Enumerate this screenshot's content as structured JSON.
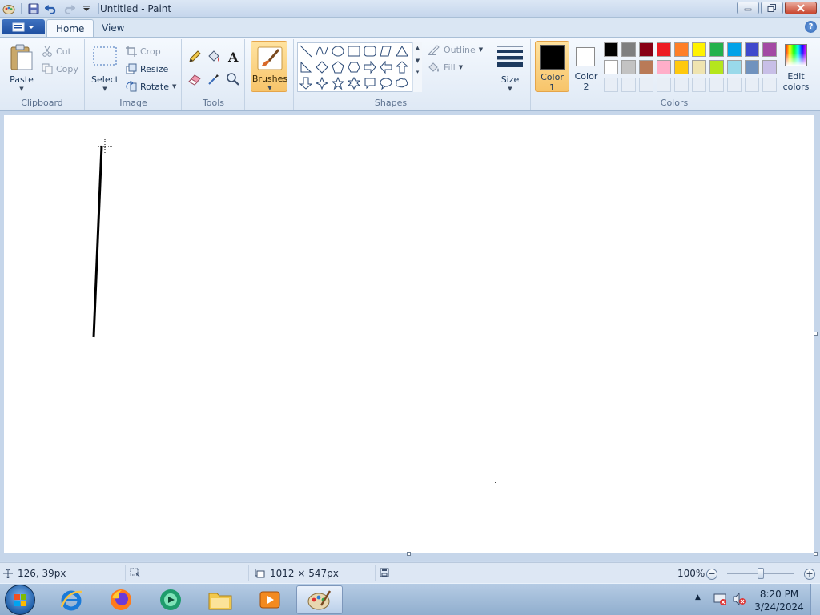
{
  "window": {
    "title": "Untitled - Paint"
  },
  "tabs": [
    {
      "label": "Home"
    },
    {
      "label": "View"
    }
  ],
  "clipboard": {
    "group_label": "Clipboard",
    "paste": "Paste",
    "cut": "Cut",
    "copy": "Copy"
  },
  "image": {
    "group_label": "Image",
    "select": "Select",
    "crop": "Crop",
    "resize": "Resize",
    "rotate": "Rotate"
  },
  "tools": {
    "group_label": "Tools"
  },
  "brushes": {
    "label": "Brushes"
  },
  "shapes": {
    "group_label": "Shapes",
    "outline": "Outline",
    "fill": "Fill"
  },
  "size": {
    "label": "Size"
  },
  "colors": {
    "group_label": "Colors",
    "color1_line1": "Color",
    "color1_line2": "1",
    "color2_line1": "Color",
    "color2_line2": "2",
    "edit_line1": "Edit",
    "edit_line2": "colors",
    "color1_value": "#000000",
    "color2_value": "#ffffff",
    "palette_row1": [
      "#000000",
      "#7f7f7f",
      "#880015",
      "#ed1c24",
      "#ff7f27",
      "#fff200",
      "#22b14c",
      "#00a2e8",
      "#3f48cc",
      "#a349a4"
    ],
    "palette_row2": [
      "#ffffff",
      "#c3c3c3",
      "#b97a57",
      "#ffaec9",
      "#ffc90e",
      "#efe4b0",
      "#b5e61d",
      "#99d9ea",
      "#7092be",
      "#c8bfe7"
    ]
  },
  "status": {
    "cursor_pos": "126, 39px",
    "canvas_size": "1012 × 547px",
    "zoom": "100%"
  },
  "taskbar": {
    "time": "8:20 PM",
    "date": "3/24/2024"
  }
}
